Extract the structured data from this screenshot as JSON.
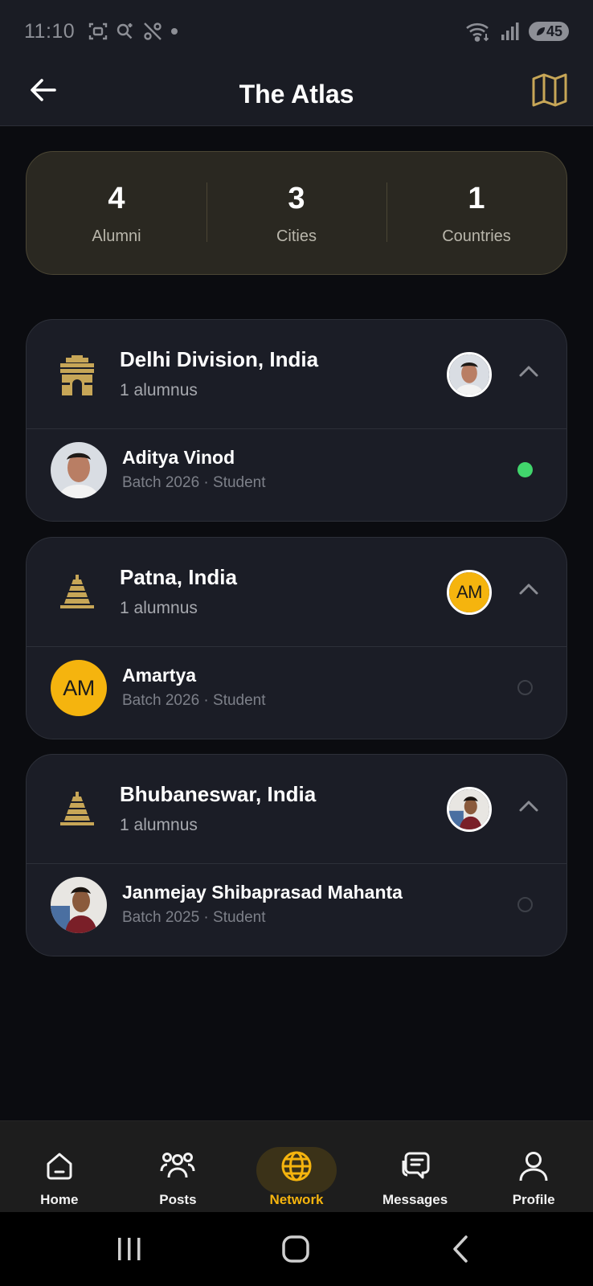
{
  "status_bar": {
    "time": "11:10",
    "battery": "45"
  },
  "header": {
    "title": "The Atlas"
  },
  "stats": [
    {
      "value": "4",
      "label": "Alumni"
    },
    {
      "value": "3",
      "label": "Cities"
    },
    {
      "value": "1",
      "label": "Countries"
    }
  ],
  "cities": [
    {
      "name": "Delhi Division, India",
      "count": "1 alumnus",
      "icon": "india-gate-icon",
      "members": [
        {
          "name": "Aditya Vinod",
          "meta": "Batch 2026 · Student",
          "online": true
        }
      ]
    },
    {
      "name": "Patna, India",
      "count": "1 alumnus",
      "icon": "stupa-icon",
      "avatar_initials": "AM",
      "members": [
        {
          "name": "Amartya",
          "meta": "Batch 2026 · Student",
          "initials": "AM",
          "online": false
        }
      ]
    },
    {
      "name": "Bhubaneswar, India",
      "count": "1 alumnus",
      "icon": "temple-icon",
      "members": [
        {
          "name": "Janmejay Shibaprasad Mahanta",
          "meta": "Batch 2025 · Student",
          "online": false
        }
      ]
    }
  ],
  "bottom_nav": {
    "items": [
      {
        "label": "Home",
        "icon": "home-icon"
      },
      {
        "label": "Posts",
        "icon": "people-icon"
      },
      {
        "label": "Network",
        "icon": "globe-icon",
        "active": true
      },
      {
        "label": "Messages",
        "icon": "chat-icon"
      },
      {
        "label": "Profile",
        "icon": "profile-icon"
      }
    ]
  },
  "colors": {
    "accent": "#f5b40e",
    "online": "#41d56c",
    "card": "#1b1d26",
    "stats_card": "#2a2821"
  }
}
